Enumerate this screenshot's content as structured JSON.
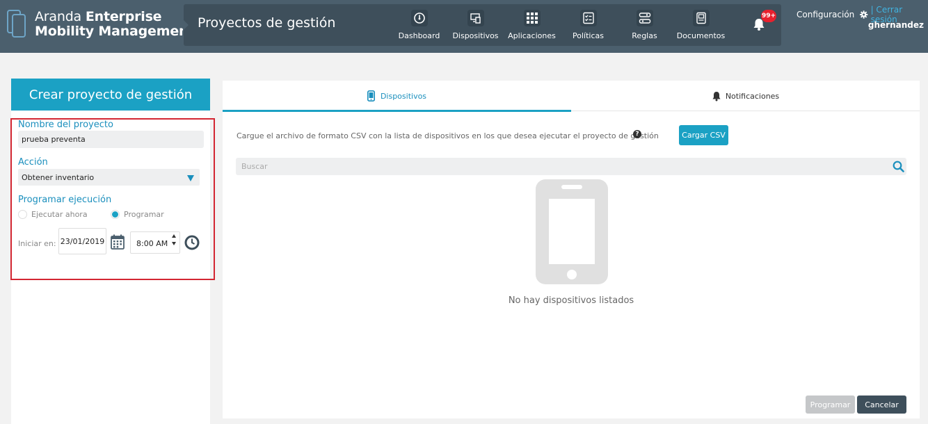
{
  "brand": {
    "line1_light": "Aranda",
    "line1_bold": "Enterprise",
    "line2": "Mobility Management"
  },
  "header": {
    "page_title": "Proyectos de gestión"
  },
  "nav": {
    "items": [
      {
        "label": "Dashboard",
        "icon": "dashboard-gauge-icon"
      },
      {
        "label": "Dispositivos",
        "icon": "devices-icon"
      },
      {
        "label": "Aplicaciones",
        "icon": "apps-grid-icon"
      },
      {
        "label": "Políticas",
        "icon": "checklist-icon"
      },
      {
        "label": "Reglas",
        "icon": "rules-icon"
      },
      {
        "label": "Documentos",
        "icon": "document-icon"
      }
    ],
    "notifications_badge": "99+"
  },
  "user": {
    "config_label": "Configuración",
    "logout_label": "| Cerrar sesión",
    "username": "ghernandez"
  },
  "left": {
    "header": "Crear proyecto de gestión",
    "project_name_label": "Nombre del proyecto",
    "project_name_value": "prueba preventa",
    "action_label": "Acción",
    "action_value": "Obtener inventario",
    "schedule_label": "Programar ejecución",
    "radio_now": "Ejecutar ahora",
    "radio_schedule": "Programar",
    "schedule_selected": "Programar",
    "start_label": "Iniciar en:",
    "date_value": "23/01/2019",
    "time_value": "8:00 AM"
  },
  "right": {
    "tabs": [
      {
        "label": "Dispositivos",
        "active": true
      },
      {
        "label": "Notificaciones",
        "active": false
      }
    ],
    "csv_instruction": "Cargue el archivo de formato CSV con la lista de dispositivos en los que desea ejecutar el proyecto de gestión",
    "csv_button": "Cargar CSV",
    "search_placeholder": "Buscar",
    "empty_message": "No hay dispositivos listados",
    "schedule_button": "Programar",
    "cancel_button": "Cancelar"
  },
  "colors": {
    "accent": "#1ba1c4",
    "header": "#4b5f6d",
    "highlight": "#d32632"
  }
}
